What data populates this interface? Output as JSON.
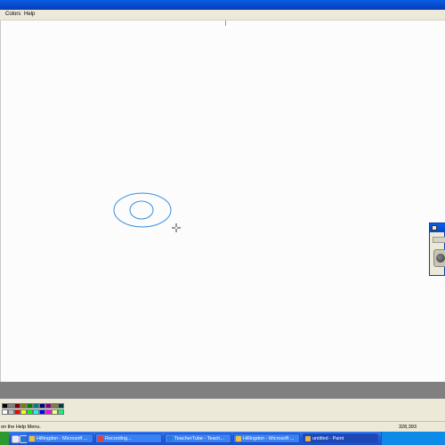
{
  "menu": {
    "items": [
      "Colors",
      "Help"
    ]
  },
  "status": {
    "help_text": "on the Help Menu.",
    "coordinates": "328,393"
  },
  "palette": {
    "colors": [
      "#000000",
      "#7f7f7f",
      "#7f0000",
      "#7f7f00",
      "#007f00",
      "#007f7f",
      "#00007f",
      "#7f007f",
      "#7f7f3f",
      "#003f3f",
      "#ffffff",
      "#c0c0c0",
      "#ff0000",
      "#ffff00",
      "#00ff00",
      "#00ffff",
      "#0000ff",
      "#ff00ff",
      "#ffff7f",
      "#00ff7f"
    ]
  },
  "taskbar": {
    "buttons": [
      {
        "label": "Hillingdon - Microsoft ...",
        "icon_color": "#f0c040"
      },
      {
        "label": "Recording...",
        "icon_color": "#e04040"
      },
      {
        "label": "TeacherTube - Teach...",
        "icon_color": "#2a7ad8"
      },
      {
        "label": "Hillingdon - Microsoft ...",
        "icon_color": "#f0c040"
      },
      {
        "label": "untitled - Paint",
        "icon_color": "#e8b040"
      }
    ]
  },
  "drawing": {
    "stroke_color": "#3a8ee0"
  },
  "colors": {
    "title_blue": "#0648c8",
    "taskbar_blue": "#245edb",
    "chrome": "#ece9d8"
  }
}
